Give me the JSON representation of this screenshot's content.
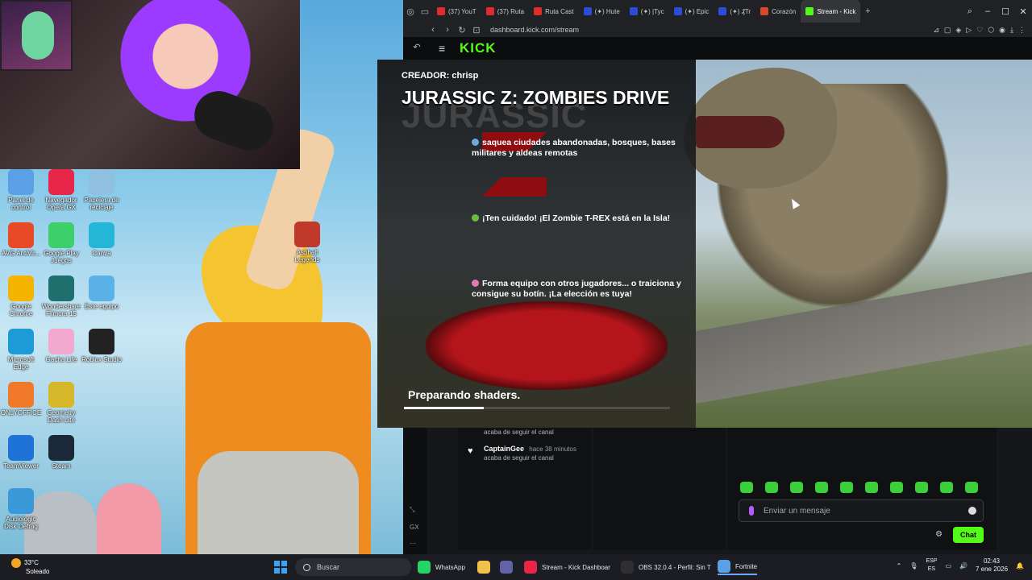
{
  "desktop": {
    "icons": [
      {
        "label": "Panel de control",
        "color": "#5aa0e6"
      },
      {
        "label": "Navegador Opera GX",
        "color": "#e8264a"
      },
      {
        "label": "Papelera de reciclaje",
        "color": "#8fc0e0"
      },
      {
        "label": "AVG AntiVir...",
        "color": "#e84a27"
      },
      {
        "label": "Google Play Juegos",
        "color": "#3ccf6a"
      },
      {
        "label": "Canva",
        "color": "#23b6d6"
      },
      {
        "label": "Asphalt Legends",
        "color": "#c0392b"
      },
      {
        "label": "Google Chrome",
        "color": "#f4b400"
      },
      {
        "label": "Wondershare Filmora 15",
        "color": "#1f6f6f"
      },
      {
        "label": "Este equipo",
        "color": "#5ab2e8"
      },
      {
        "label": "Microsoft Edge",
        "color": "#1d9bd6"
      },
      {
        "label": "Gacha Life",
        "color": "#f3a8d0"
      },
      {
        "label": "Roblox Studio",
        "color": "#222222"
      },
      {
        "label": "ONLYOFFICE",
        "color": "#f07a2a"
      },
      {
        "label": "Geometry Dash Lite",
        "color": "#d6b72a"
      },
      {
        "label": "TeamViewer",
        "color": "#1f73d8"
      },
      {
        "label": "Steam",
        "color": "#1b2838"
      },
      {
        "label": "Audiologic Disk Defrag",
        "color": "#3a9ad9"
      }
    ]
  },
  "browser": {
    "tabs": [
      {
        "label": "(37) YouT",
        "color": "#e02b2b"
      },
      {
        "label": "(37) Ruta",
        "color": "#e02b2b"
      },
      {
        "label": "Ruta Cast",
        "color": "#e02b2b"
      },
      {
        "label": "(✦) Hute",
        "color": "#2b4bd9"
      },
      {
        "label": "(✦) |Tyc",
        "color": "#2b4bd9"
      },
      {
        "label": "(✦) Epic",
        "color": "#2b4bd9"
      },
      {
        "label": "(✦) ₰Tr",
        "color": "#2b4bd9"
      },
      {
        "label": "Corazón",
        "color": "#d9482b"
      },
      {
        "label": "Stream - Kick",
        "color": "#53fc18",
        "active": true
      }
    ],
    "url": "dashboard.kick.com/stream",
    "kick_logo": "KICK",
    "activity": [
      {
        "name": "",
        "time": "",
        "desc": "acaba de seguir el canal"
      },
      {
        "name": "CaptainGee",
        "time": "hace 38 minutos",
        "desc": "acaba de seguir el canal"
      }
    ],
    "rail_labels": [
      "GX"
    ],
    "chat": {
      "placeholder": "Enviar un mensaje",
      "button": "Chat"
    }
  },
  "game": {
    "creator": "CREADOR: chrisp",
    "title": "JURASSIC Z: ZOMBIES DRIVE",
    "logo_word": "JURASSIC",
    "bullets": [
      {
        "text": "saquea ciudades abandonadas, bosques, bases militares y aldeas remotas",
        "color": "#6fa8dc"
      },
      {
        "text": "¡Ten cuidado! ¡El Zombie T-REX está en la Isla!",
        "color": "#6abf3a"
      },
      {
        "text": "Forma equipo con otros jugadores... o traiciona y consigue su botín. ¡La elección es tuya!",
        "color": "#e07ab0"
      }
    ],
    "loading_text": "Preparando shaders.",
    "loading_progress": 0.3
  },
  "taskbar": {
    "weather": {
      "temp": "33°C",
      "desc": "Soleado"
    },
    "search": "Buscar",
    "apps": [
      {
        "label": "WhatsApp",
        "color": "#25d366"
      },
      {
        "label": "",
        "color": "#f0c24a"
      },
      {
        "label": "",
        "color": "#6264a7"
      },
      {
        "label": "Stream - Kick Dashboar",
        "color": "#e8264a"
      },
      {
        "label": "OBS 32.0.4 - Perfil: Sin T",
        "color": "#302e31"
      },
      {
        "label": "Fortnite",
        "color": "#5aa0e6",
        "active": true
      }
    ],
    "lang": "ESP",
    "region": "ES",
    "time": "02:43",
    "date": "7 ene 2026"
  }
}
